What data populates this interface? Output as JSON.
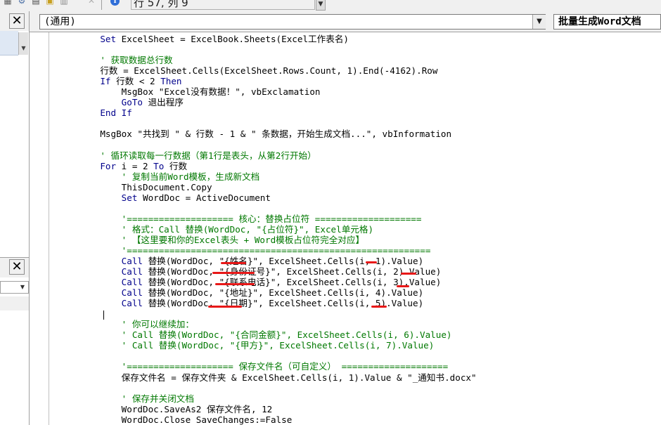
{
  "toolbar": {
    "cursor_position": "行 57, 列 9",
    "icons": [
      "palette-icon",
      "prop-icon",
      "object-icon",
      "toolbox-icon",
      "disabled-icon",
      "help-info-icon"
    ]
  },
  "code_header": {
    "object_combo": "(通用)",
    "procedure_combo": "批量生成Word文档"
  },
  "code": {
    "lines": [
      [
        {
          "t": "    Set ",
          "k": "kw"
        },
        {
          "t": "ExcelSheet = ExcelBook.Sheets(Excel工作表名)",
          "k": "pl"
        }
      ],
      [
        {
          "t": "",
          "k": "pl"
        }
      ],
      [
        {
          "t": "    ' 获取数据总行数",
          "k": "cm"
        }
      ],
      [
        {
          "t": "    行数 = ExcelSheet.Cells(ExcelSheet.Rows.Count, 1).End(-4162).Row",
          "k": "pl"
        }
      ],
      [
        {
          "t": "    If ",
          "k": "kw"
        },
        {
          "t": "行数 < 2 ",
          "k": "pl"
        },
        {
          "t": "Then",
          "k": "kw"
        }
      ],
      [
        {
          "t": "        MsgBox \"Excel没有数据！\", vbExclamation",
          "k": "pl"
        }
      ],
      [
        {
          "t": "        GoTo ",
          "k": "kw"
        },
        {
          "t": "退出程序",
          "k": "pl"
        }
      ],
      [
        {
          "t": "    End If",
          "k": "kw"
        }
      ],
      [
        {
          "t": "",
          "k": "pl"
        }
      ],
      [
        {
          "t": "    MsgBox \"共找到 \" & 行数 - 1 & \" 条数据，开始生成文档...\", vbInformation",
          "k": "pl"
        }
      ],
      [
        {
          "t": "",
          "k": "pl"
        }
      ],
      [
        {
          "t": "    ' 循环读取每一行数据（第1行是表头，从第2行开始）",
          "k": "cm"
        }
      ],
      [
        {
          "t": "    For ",
          "k": "kw"
        },
        {
          "t": "i = 2 ",
          "k": "pl"
        },
        {
          "t": "To ",
          "k": "kw"
        },
        {
          "t": "行数",
          "k": "pl"
        }
      ],
      [
        {
          "t": "        ' 复制当前Word模板，生成新文档",
          "k": "cm"
        }
      ],
      [
        {
          "t": "        ThisDocument.Copy",
          "k": "pl"
        }
      ],
      [
        {
          "t": "        Set ",
          "k": "kw"
        },
        {
          "t": "WordDoc = ActiveDocument",
          "k": "pl"
        }
      ],
      [
        {
          "t": "",
          "k": "pl"
        }
      ],
      [
        {
          "t": "        '==================== 核心：替换占位符 ====================",
          "k": "cm"
        }
      ],
      [
        {
          "t": "        ' 格式：Call 替换(WordDoc, \"{占位符}\", Excel单元格)",
          "k": "cm"
        }
      ],
      [
        {
          "t": "        ' 【这里要和你的Excel表头 + Word模板占位符完全对应】",
          "k": "cm"
        }
      ],
      [
        {
          "t": "        '=========================================================",
          "k": "cm"
        }
      ],
      [
        {
          "t": "        Call ",
          "k": "kw"
        },
        {
          "t": "替换(WordDoc, \"{姓名}\", ExcelSheet.Cells(i, 1).Value)",
          "k": "pl"
        }
      ],
      [
        {
          "t": "        Call ",
          "k": "kw"
        },
        {
          "t": "替换(WordDoc, \"{身份证号}\", ExcelSheet.Cells(i, 2).Value)",
          "k": "pl"
        }
      ],
      [
        {
          "t": "        Call ",
          "k": "kw"
        },
        {
          "t": "替换(WordDoc, \"{联系电话}\", ExcelSheet.Cells(i, 3).Value)",
          "k": "pl"
        }
      ],
      [
        {
          "t": "        Call ",
          "k": "kw"
        },
        {
          "t": "替换(WordDoc, \"{地址}\", ExcelSheet.Cells(i, 4).Value)",
          "k": "pl"
        }
      ],
      [
        {
          "t": "        Call ",
          "k": "kw"
        },
        {
          "t": "替换(WordDoc, \"{日期}\", ExcelSheet.Cells(i, 5).Value)",
          "k": "pl"
        }
      ],
      [
        {
          "t": "",
          "k": "pl"
        }
      ],
      [
        {
          "t": "        ' 你可以继续加：",
          "k": "cm"
        }
      ],
      [
        {
          "t": "        ' Call 替换(WordDoc, \"{合同金额}\", ExcelSheet.Cells(i, 6).Value)",
          "k": "cm"
        }
      ],
      [
        {
          "t": "        ' Call 替换(WordDoc, \"{甲方}\", ExcelSheet.Cells(i, 7).Value)",
          "k": "cm"
        }
      ],
      [
        {
          "t": "",
          "k": "pl"
        }
      ],
      [
        {
          "t": "        '==================== 保存文件名（可自定义） ====================",
          "k": "cm"
        }
      ],
      [
        {
          "t": "        保存文件名 = 保存文件夹 & ExcelSheet.Cells(i, 1).Value & \"_通知书.docx\"",
          "k": "pl"
        }
      ],
      [
        {
          "t": "",
          "k": "pl"
        }
      ],
      [
        {
          "t": "        ' 保存并关闭文档",
          "k": "cm"
        }
      ],
      [
        {
          "t": "        WordDoc.SaveAs2 保存文件名, 12",
          "k": "pl"
        }
      ],
      [
        {
          "t": "        WordDoc.Close SaveChanges:=False",
          "k": "pl"
        }
      ]
    ]
  },
  "colors": {
    "keyword": "#00008b",
    "comment": "#007800",
    "annotation": "#e81818"
  }
}
